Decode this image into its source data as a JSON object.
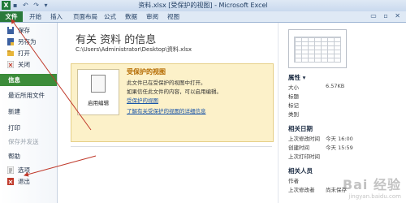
{
  "window": {
    "app_letter": "X",
    "title": "资料.xlsx  [受保护的视图] - Microsoft Excel",
    "qat": "▪ ↶ ↷ ▾",
    "controls": "▭ ▫ ✕"
  },
  "ribbon_tabs": [
    "文件",
    "开始",
    "插入",
    "页面布局",
    "公式",
    "数据",
    "审阅",
    "视图"
  ],
  "nav": {
    "top_items": [
      {
        "label": "保存",
        "icon": "save-icon"
      },
      {
        "label": "另存为",
        "icon": "save-as-icon"
      },
      {
        "label": "打开",
        "icon": "open-folder-icon"
      },
      {
        "label": "关闭",
        "icon": "close-file-icon"
      }
    ],
    "selected": "信息",
    "sections": [
      "最近所用文件",
      "新建",
      "打印",
      "保存并发送",
      "帮助"
    ],
    "bottom_items": [
      {
        "label": "选项",
        "icon": "options-icon"
      },
      {
        "label": "退出",
        "icon": "exit-icon"
      }
    ]
  },
  "info": {
    "title": "有关 资料 的信息",
    "path": "C:\\Users\\Administrator\\Desktop\\资料.xlsx"
  },
  "protected_card": {
    "button_label": "启用编辑",
    "heading": "受保护的视图",
    "lines": [
      "此文件已在受保护的视图中打开。",
      "如果信任此文件的内容，可以启用编辑。",
      "受保护的视图"
    ],
    "footer": "了解有关受保护的视图的详细信息"
  },
  "properties": {
    "header": "属性 ▾",
    "rows": [
      {
        "k": "大小",
        "v": "6.57KB"
      },
      {
        "k": "标题",
        "v": ""
      },
      {
        "k": "标记",
        "v": ""
      },
      {
        "k": "类别",
        "v": ""
      }
    ],
    "dates_header": "相关日期",
    "dates": [
      {
        "k": "上次修改时间",
        "v": "今天 16:00"
      },
      {
        "k": "创建时间",
        "v": "今天 15:59"
      },
      {
        "k": "上次打印时间",
        "v": ""
      }
    ],
    "people_header": "相关人员",
    "people": [
      {
        "k": "作者",
        "v": ""
      },
      {
        "k": "上次修改者",
        "v": "尚未保存"
      }
    ]
  },
  "watermark": {
    "text": "Bai 经验",
    "sub": "jingyan.baidu.com"
  },
  "colors": {
    "file_tab": "#2a7a3b",
    "selected_nav": "#3c8c3a",
    "card_bg": "#fcf1c9",
    "arrow": "#c0392b"
  }
}
